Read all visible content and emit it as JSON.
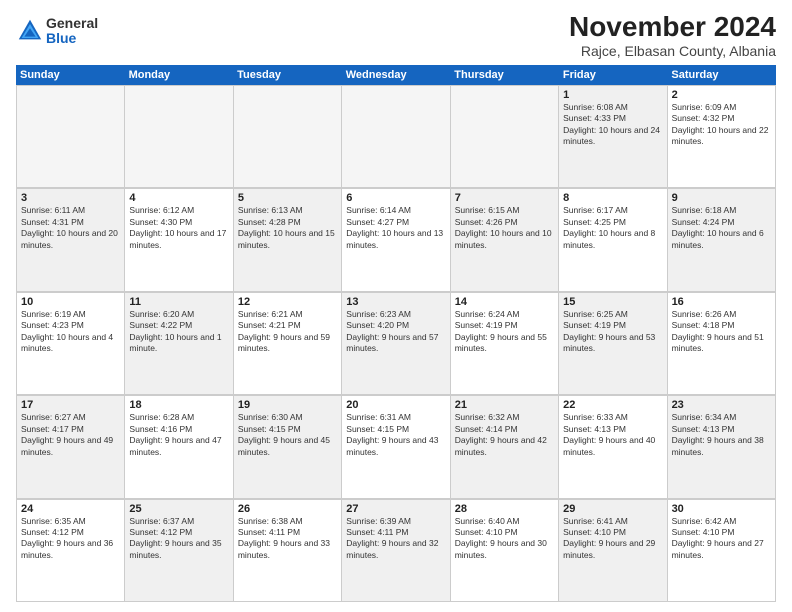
{
  "header": {
    "logo_general": "General",
    "logo_blue": "Blue",
    "month_title": "November 2024",
    "subtitle": "Rajce, Elbasan County, Albania"
  },
  "calendar": {
    "days_of_week": [
      "Sunday",
      "Monday",
      "Tuesday",
      "Wednesday",
      "Thursday",
      "Friday",
      "Saturday"
    ],
    "weeks": [
      [
        {
          "day": "",
          "info": "",
          "empty": true
        },
        {
          "day": "",
          "info": "",
          "empty": true
        },
        {
          "day": "",
          "info": "",
          "empty": true
        },
        {
          "day": "",
          "info": "",
          "empty": true
        },
        {
          "day": "",
          "info": "",
          "empty": true
        },
        {
          "day": "1",
          "info": "Sunrise: 6:08 AM\nSunset: 4:33 PM\nDaylight: 10 hours and 24 minutes.",
          "shaded": true
        },
        {
          "day": "2",
          "info": "Sunrise: 6:09 AM\nSunset: 4:32 PM\nDaylight: 10 hours and 22 minutes.",
          "shaded": false
        }
      ],
      [
        {
          "day": "3",
          "info": "Sunrise: 6:11 AM\nSunset: 4:31 PM\nDaylight: 10 hours and 20 minutes.",
          "shaded": true
        },
        {
          "day": "4",
          "info": "Sunrise: 6:12 AM\nSunset: 4:30 PM\nDaylight: 10 hours and 17 minutes.",
          "shaded": false
        },
        {
          "day": "5",
          "info": "Sunrise: 6:13 AM\nSunset: 4:28 PM\nDaylight: 10 hours and 15 minutes.",
          "shaded": true
        },
        {
          "day": "6",
          "info": "Sunrise: 6:14 AM\nSunset: 4:27 PM\nDaylight: 10 hours and 13 minutes.",
          "shaded": false
        },
        {
          "day": "7",
          "info": "Sunrise: 6:15 AM\nSunset: 4:26 PM\nDaylight: 10 hours and 10 minutes.",
          "shaded": true
        },
        {
          "day": "8",
          "info": "Sunrise: 6:17 AM\nSunset: 4:25 PM\nDaylight: 10 hours and 8 minutes.",
          "shaded": false
        },
        {
          "day": "9",
          "info": "Sunrise: 6:18 AM\nSunset: 4:24 PM\nDaylight: 10 hours and 6 minutes.",
          "shaded": true
        }
      ],
      [
        {
          "day": "10",
          "info": "Sunrise: 6:19 AM\nSunset: 4:23 PM\nDaylight: 10 hours and 4 minutes.",
          "shaded": false
        },
        {
          "day": "11",
          "info": "Sunrise: 6:20 AM\nSunset: 4:22 PM\nDaylight: 10 hours and 1 minute.",
          "shaded": true
        },
        {
          "day": "12",
          "info": "Sunrise: 6:21 AM\nSunset: 4:21 PM\nDaylight: 9 hours and 59 minutes.",
          "shaded": false
        },
        {
          "day": "13",
          "info": "Sunrise: 6:23 AM\nSunset: 4:20 PM\nDaylight: 9 hours and 57 minutes.",
          "shaded": true
        },
        {
          "day": "14",
          "info": "Sunrise: 6:24 AM\nSunset: 4:19 PM\nDaylight: 9 hours and 55 minutes.",
          "shaded": false
        },
        {
          "day": "15",
          "info": "Sunrise: 6:25 AM\nSunset: 4:19 PM\nDaylight: 9 hours and 53 minutes.",
          "shaded": true
        },
        {
          "day": "16",
          "info": "Sunrise: 6:26 AM\nSunset: 4:18 PM\nDaylight: 9 hours and 51 minutes.",
          "shaded": false
        }
      ],
      [
        {
          "day": "17",
          "info": "Sunrise: 6:27 AM\nSunset: 4:17 PM\nDaylight: 9 hours and 49 minutes.",
          "shaded": true
        },
        {
          "day": "18",
          "info": "Sunrise: 6:28 AM\nSunset: 4:16 PM\nDaylight: 9 hours and 47 minutes.",
          "shaded": false
        },
        {
          "day": "19",
          "info": "Sunrise: 6:30 AM\nSunset: 4:15 PM\nDaylight: 9 hours and 45 minutes.",
          "shaded": true
        },
        {
          "day": "20",
          "info": "Sunrise: 6:31 AM\nSunset: 4:15 PM\nDaylight: 9 hours and 43 minutes.",
          "shaded": false
        },
        {
          "day": "21",
          "info": "Sunrise: 6:32 AM\nSunset: 4:14 PM\nDaylight: 9 hours and 42 minutes.",
          "shaded": true
        },
        {
          "day": "22",
          "info": "Sunrise: 6:33 AM\nSunset: 4:13 PM\nDaylight: 9 hours and 40 minutes.",
          "shaded": false
        },
        {
          "day": "23",
          "info": "Sunrise: 6:34 AM\nSunset: 4:13 PM\nDaylight: 9 hours and 38 minutes.",
          "shaded": true
        }
      ],
      [
        {
          "day": "24",
          "info": "Sunrise: 6:35 AM\nSunset: 4:12 PM\nDaylight: 9 hours and 36 minutes.",
          "shaded": false
        },
        {
          "day": "25",
          "info": "Sunrise: 6:37 AM\nSunset: 4:12 PM\nDaylight: 9 hours and 35 minutes.",
          "shaded": true
        },
        {
          "day": "26",
          "info": "Sunrise: 6:38 AM\nSunset: 4:11 PM\nDaylight: 9 hours and 33 minutes.",
          "shaded": false
        },
        {
          "day": "27",
          "info": "Sunrise: 6:39 AM\nSunset: 4:11 PM\nDaylight: 9 hours and 32 minutes.",
          "shaded": true
        },
        {
          "day": "28",
          "info": "Sunrise: 6:40 AM\nSunset: 4:10 PM\nDaylight: 9 hours and 30 minutes.",
          "shaded": false
        },
        {
          "day": "29",
          "info": "Sunrise: 6:41 AM\nSunset: 4:10 PM\nDaylight: 9 hours and 29 minutes.",
          "shaded": true
        },
        {
          "day": "30",
          "info": "Sunrise: 6:42 AM\nSunset: 4:10 PM\nDaylight: 9 hours and 27 minutes.",
          "shaded": false
        }
      ]
    ]
  }
}
